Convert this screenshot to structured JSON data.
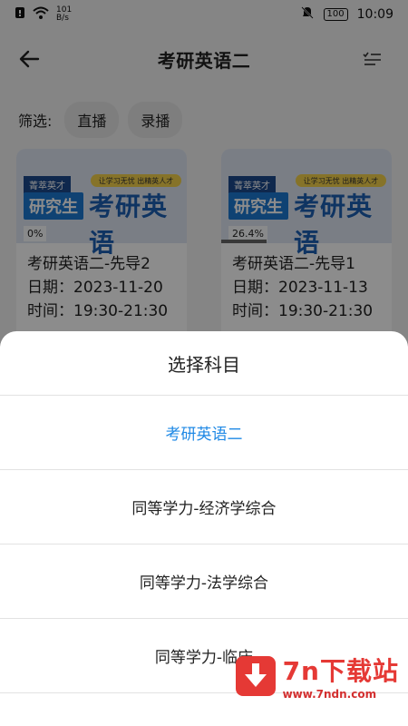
{
  "status_bar": {
    "net_speed_value": "101",
    "net_speed_unit": "B/s",
    "battery": "100",
    "time": "10:09"
  },
  "header": {
    "title": "考研英语二"
  },
  "filter": {
    "label": "筛选:",
    "chips": [
      "直播",
      "录播"
    ]
  },
  "cards": [
    {
      "thumb_brand": "菁萃英才",
      "thumb_badge": "让学习无忧 出精英人才",
      "thumb_pill": "研究生",
      "thumb_title": "考研英语",
      "progress_text": "0%",
      "progress": 0,
      "title": "考研英语二-先导2",
      "date": "日期：2023-11-20",
      "time": "时间：19:30-21:30"
    },
    {
      "thumb_brand": "菁萃英才",
      "thumb_badge": "让学习无忧 出精英人才",
      "thumb_pill": "研究生",
      "thumb_title": "考研英语",
      "progress_text": "26.4%",
      "progress": 0.264,
      "title": "考研英语二-先导1",
      "date": "日期：2023-11-13",
      "time": "时间：19:30-21:30"
    }
  ],
  "sheet": {
    "title": "选择科目",
    "options": [
      {
        "label": "考研英语二",
        "selected": true
      },
      {
        "label": "同等学力-经济学综合",
        "selected": false
      },
      {
        "label": "同等学力-法学综合",
        "selected": false
      },
      {
        "label": "同等学力-临床",
        "selected": false
      }
    ],
    "selected_color": "#1e88e5"
  },
  "watermark": {
    "name": "7n下载站",
    "url": "www.7ndn.com",
    "color": "#e53935"
  }
}
